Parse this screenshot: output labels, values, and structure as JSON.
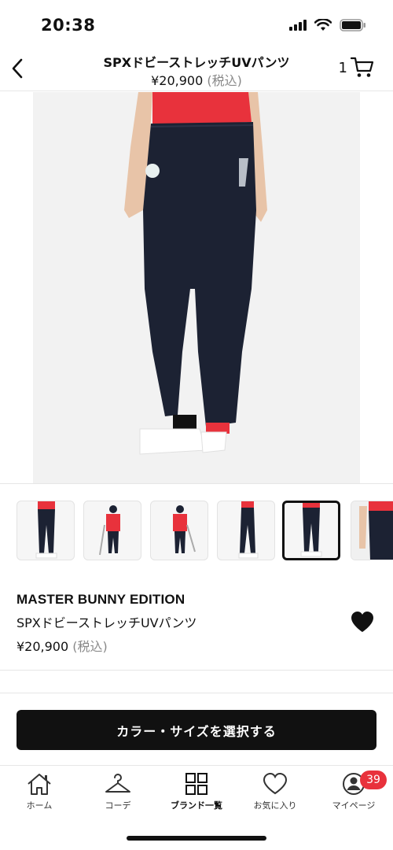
{
  "status_bar": {
    "time": "20:38"
  },
  "header": {
    "title": "SPXドビーストレッチUVパンツ",
    "price": "¥20,900",
    "tax_note": "(税込)",
    "cart_count": "1"
  },
  "colors": {
    "pants": "#1c2233",
    "shirt": "#e8323c",
    "accent": "#111111",
    "badge": "#e8323c"
  },
  "gallery": {
    "thumbnail_count": 6,
    "active_index": 4
  },
  "product": {
    "brand": "MASTER BUNNY EDITION",
    "name": "SPXドビーストレッチUVパンツ",
    "price": "¥20,900",
    "tax_note": "(税込)"
  },
  "cta_label": "カラー・サイズを選択する",
  "tabbar": {
    "items": [
      {
        "label": "ホーム",
        "icon": "home-icon"
      },
      {
        "label": "コーデ",
        "icon": "hanger-icon"
      },
      {
        "label": "ブランド一覧",
        "icon": "grid-icon"
      },
      {
        "label": "お気に入り",
        "icon": "heart-outline-icon"
      },
      {
        "label": "マイページ",
        "icon": "user-icon",
        "badge": "39"
      }
    ],
    "active_index": 2
  }
}
